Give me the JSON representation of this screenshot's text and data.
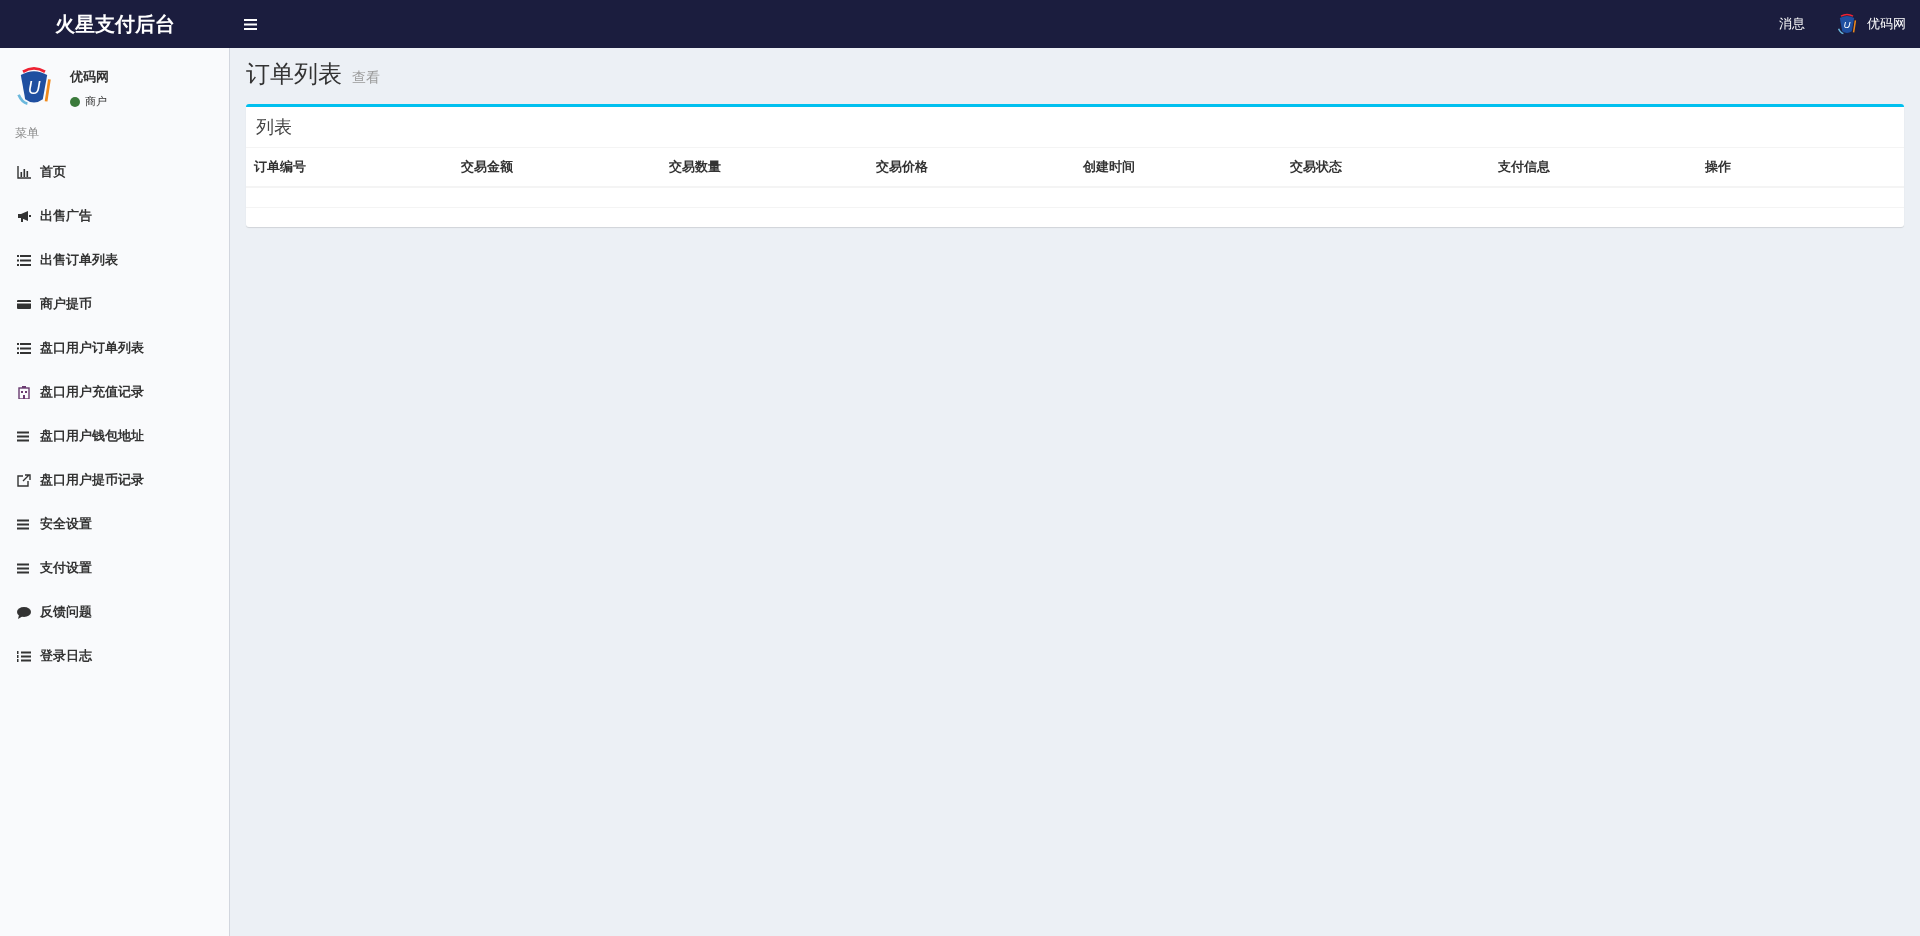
{
  "header": {
    "title": "火星支付后台",
    "messages": "消息",
    "logo_letter": "U",
    "user_name": "优码网"
  },
  "sidebar": {
    "user": {
      "logo_letter": "U",
      "name": "优码网",
      "role": "商户"
    },
    "section_label": "菜单",
    "items": [
      {
        "label": "首页"
      },
      {
        "label": "出售广告"
      },
      {
        "label": "出售订单列表"
      },
      {
        "label": "商户提币"
      },
      {
        "label": "盘口用户订单列表"
      },
      {
        "label": "盘口用户充值记录"
      },
      {
        "label": "盘口用户钱包地址"
      },
      {
        "label": "盘口用户提币记录"
      },
      {
        "label": "安全设置"
      },
      {
        "label": "支付设置"
      },
      {
        "label": "反馈问题"
      },
      {
        "label": "登录日志"
      }
    ]
  },
  "page": {
    "title": "订单列表",
    "subtitle": "查看"
  },
  "panel": {
    "title": "列表",
    "columns": [
      "订单编号",
      "交易金额",
      "交易数量",
      "交易价格",
      "创建时间",
      "交易状态",
      "支付信息",
      "操作"
    ]
  }
}
